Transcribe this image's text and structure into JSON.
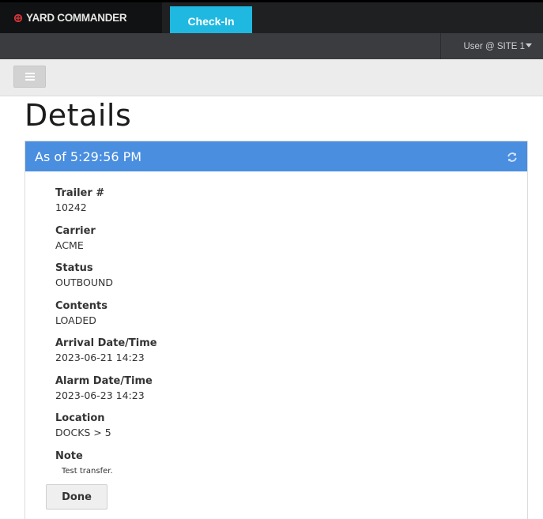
{
  "app": {
    "brand": "YARD COMMANDER",
    "active_tab": "Check-In",
    "user_menu": "User @ SITE 1"
  },
  "page": {
    "title": "Details"
  },
  "panel": {
    "heading": "As of 5:29:56 PM",
    "fields": [
      {
        "label": "Trailer #",
        "value": "10242"
      },
      {
        "label": "Carrier",
        "value": "ACME"
      },
      {
        "label": "Status",
        "value": "OUTBOUND"
      },
      {
        "label": "Contents",
        "value": "LOADED"
      },
      {
        "label": "Arrival Date/Time",
        "value": "2023-06-21 14:23"
      },
      {
        "label": "Alarm Date/Time",
        "value": "2023-06-23 14:23"
      },
      {
        "label": "Location",
        "value": "DOCKS > 5"
      },
      {
        "label": "Note",
        "value": "Test transfer."
      }
    ],
    "done_label": "Done"
  },
  "colors": {
    "topbar": "#1f2022",
    "accent_tab": "#1fb8e0",
    "panel_header": "#4a8ee0",
    "brand_icon": "#d9343a"
  },
  "icons": {
    "brand": "brand-logo-icon",
    "menu": "hamburger-icon",
    "refresh": "refresh-icon",
    "user_caret": "caret-down-icon"
  }
}
